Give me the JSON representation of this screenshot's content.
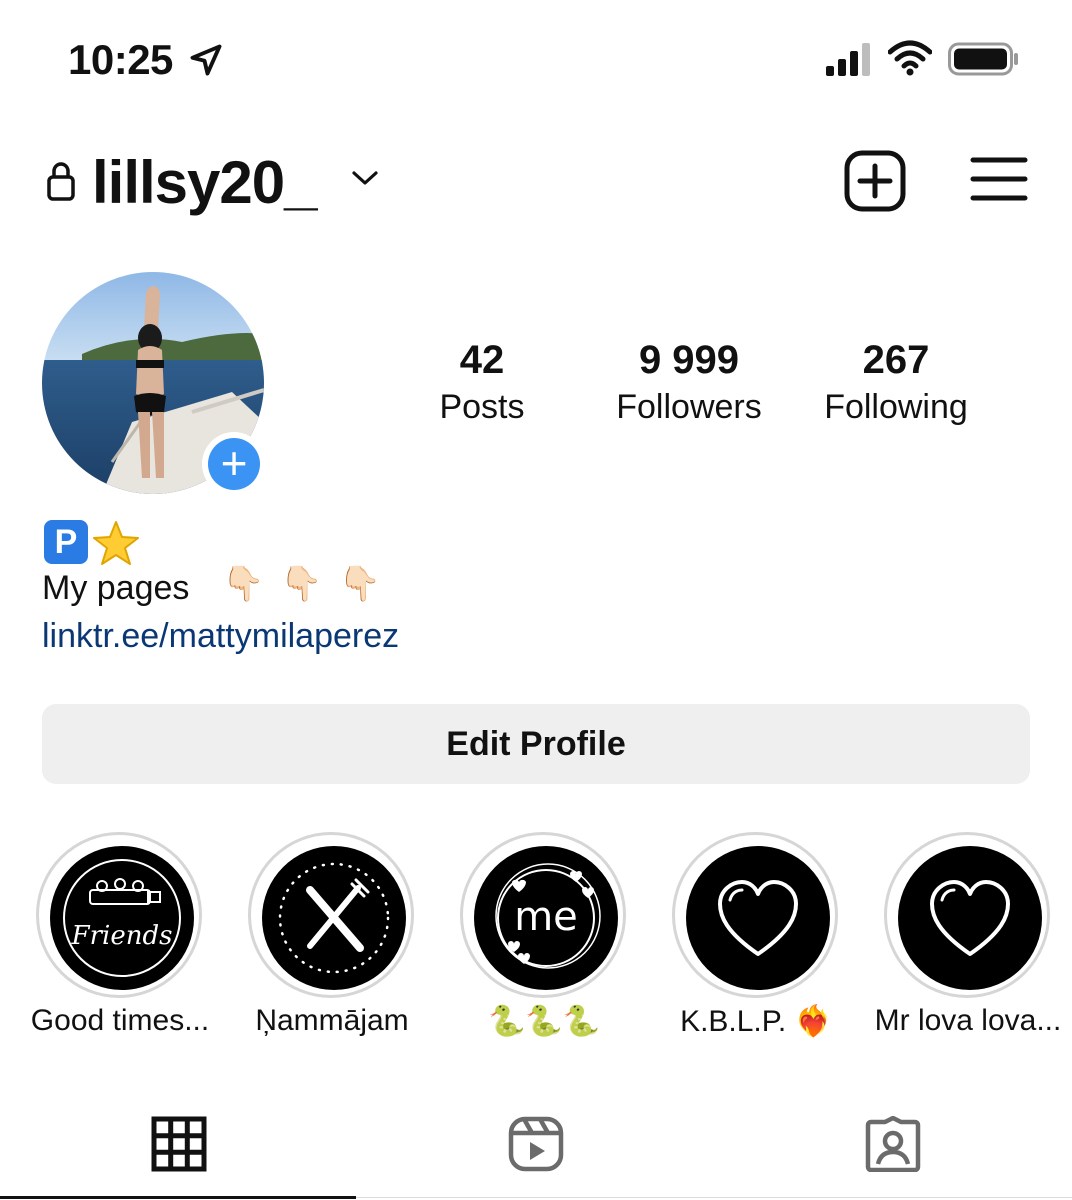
{
  "status_bar": {
    "time": "10:25"
  },
  "header": {
    "username": "lillsy20_"
  },
  "stats": {
    "posts": {
      "count": "42",
      "label": "Posts"
    },
    "followers": {
      "count": "9 999",
      "label": "Followers"
    },
    "following": {
      "count": "267",
      "label": "Following"
    }
  },
  "bio": {
    "badge_letter": "P",
    "line": "My pages",
    "pointer_emoji": "👇🏻",
    "link": "linktr.ee/mattymilaperez"
  },
  "edit_profile_label": "Edit Profile",
  "highlights": [
    {
      "label": "Good times...",
      "cover_text": "Friends",
      "icon": "friends-icon"
    },
    {
      "label": "Ņammājam",
      "icon": "fork-knife-icon"
    },
    {
      "label": "🐍🐍🐍",
      "cover_text": "me",
      "icon": "me-icon"
    },
    {
      "label": "K.B.L.P. ❤️‍🔥",
      "icon": "heart-icon"
    },
    {
      "label": "Mr lova lova...",
      "icon": "heart-icon"
    }
  ],
  "tabs": [
    {
      "name": "grid",
      "icon": "grid-icon",
      "active": true
    },
    {
      "name": "reels",
      "icon": "reels-icon",
      "active": false
    },
    {
      "name": "tagged",
      "icon": "tagged-icon",
      "active": false
    }
  ],
  "colors": {
    "accent_blue": "#3b93f3",
    "link": "#0a3875",
    "button_bg": "#efefef"
  }
}
